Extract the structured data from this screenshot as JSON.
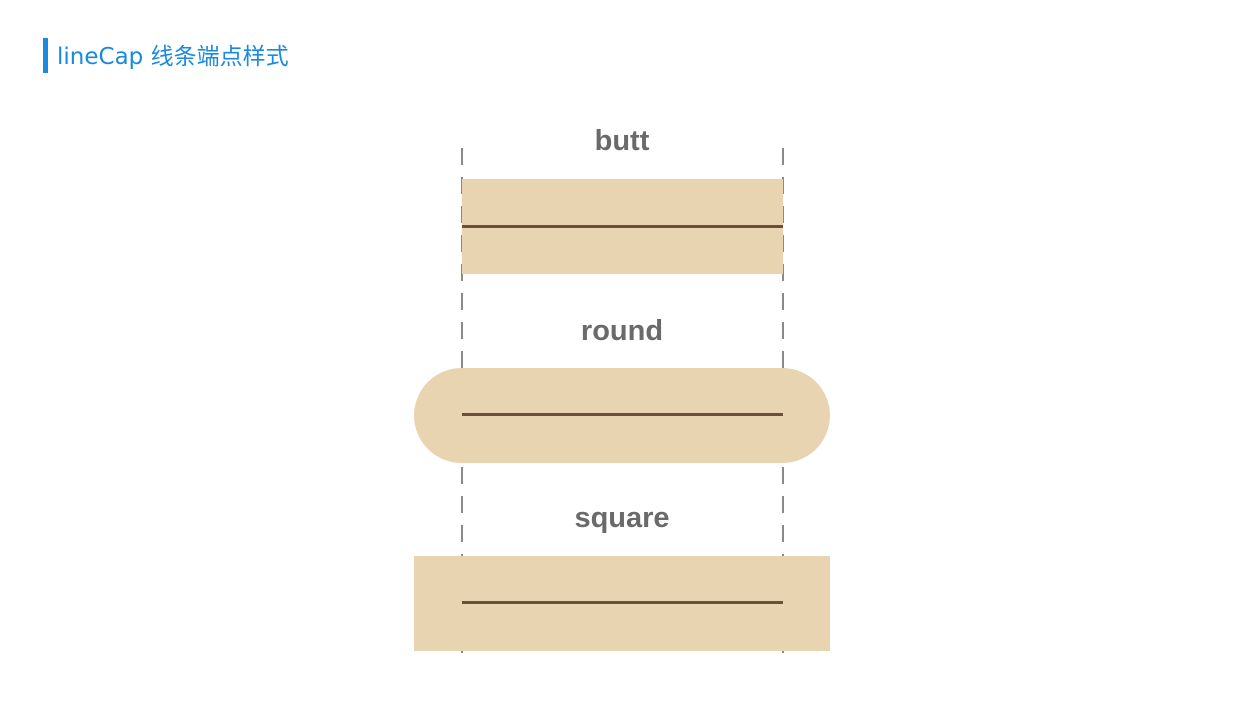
{
  "slide": {
    "title": "lineCap 线条端点样式",
    "accent_color": "#1a8ae0"
  },
  "caps": [
    {
      "label": "butt",
      "cap": "butt"
    },
    {
      "label": "round",
      "cap": "round"
    },
    {
      "label": "square",
      "cap": "square"
    }
  ],
  "colors": {
    "cap_fill": "#e8d4b1",
    "line": "#6b4f37",
    "guide": "#8a8a8a",
    "label": "#6a6a6a"
  }
}
